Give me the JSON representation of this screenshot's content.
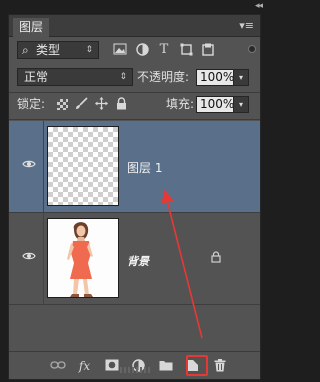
{
  "panel": {
    "tab_label": "图层",
    "collapse_glyph": "◂◂",
    "close_glyph": "✕",
    "menu_glyph": "▾≡"
  },
  "filter": {
    "search_glyph": "⌕",
    "kind_label": "类型",
    "arrow_glyph": "⇕",
    "icons": [
      "image-filter-icon",
      "adjustment-filter-icon",
      "type-filter-icon",
      "shape-filter-icon",
      "smart-object-filter-icon"
    ]
  },
  "blend": {
    "mode": "正常",
    "opacity_label": "不透明度:",
    "opacity_value": "100%",
    "dropdown_glyph": "▾"
  },
  "lock": {
    "label": "锁定:",
    "fill_label": "填充:",
    "fill_value": "100%"
  },
  "layers": [
    {
      "name": "图层 1",
      "visible": true,
      "selected": true,
      "thumbnail": "transparent"
    },
    {
      "name": "背景",
      "visible": true,
      "selected": false,
      "thumbnail": "photo",
      "locked": true
    }
  ],
  "bottom_icons": [
    "link-icon",
    "fx-icon",
    "mask-icon",
    "adjustment-icon",
    "folder-icon",
    "new-layer-icon",
    "trash-icon"
  ],
  "fx_label": "fx",
  "colors": {
    "selected_row": "#5a6f8a",
    "annotation": "#e53935"
  }
}
